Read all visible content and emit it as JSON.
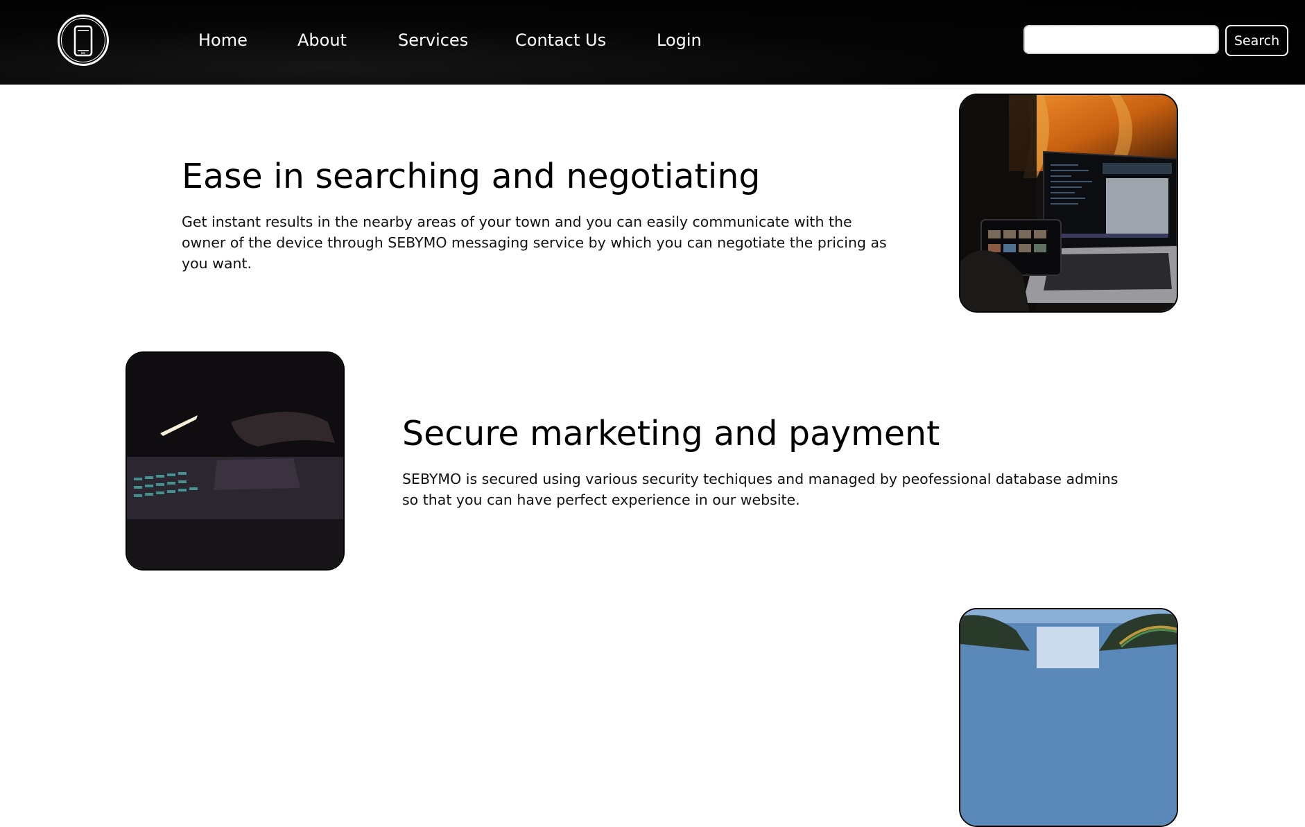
{
  "nav": {
    "items": [
      {
        "label": "Home"
      },
      {
        "label": "About"
      },
      {
        "label": "Services"
      },
      {
        "label": "Contact Us"
      },
      {
        "label": "Login"
      }
    ]
  },
  "search": {
    "placeholder": "",
    "button_label": "Search"
  },
  "features": [
    {
      "title": "Ease in searching and negotiating",
      "text": "Get instant results in the nearby areas of your town and you can easily communicate with the owner of the device through SEBYMO messaging service by which you can negotiate the pricing as you want."
    },
    {
      "title": "Secure marketing and payment",
      "text": "SEBYMO is secured using various security techiques and managed by peofessional database admins so that you can have perfect experience in our website."
    }
  ],
  "colors": {
    "header_bg": "#000000",
    "page_bg": "#ffffff",
    "text": "#111111"
  },
  "icons": {
    "logo": "smartphone-icon"
  }
}
